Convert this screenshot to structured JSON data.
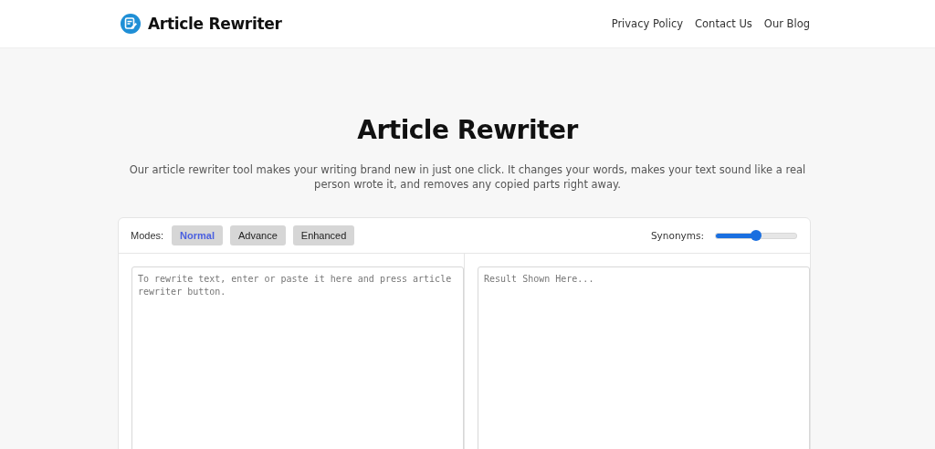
{
  "header": {
    "brand": "Article Rewriter",
    "nav": [
      "Privacy Policy",
      "Contact Us",
      "Our Blog"
    ]
  },
  "hero": {
    "title": "Article Rewriter",
    "description": "Our article rewriter tool makes your writing brand new in just one click. It changes your words, makes your text sound like a real person wrote it, and removes any copied parts right away."
  },
  "toolbar": {
    "modes_label": "Modes:",
    "modes": [
      {
        "label": "Normal",
        "selected": true
      },
      {
        "label": "Advance",
        "selected": false
      },
      {
        "label": "Enhanced",
        "selected": false
      }
    ],
    "synonyms_label": "Synonyms:",
    "synonyms": {
      "level": 0.5
    }
  },
  "input": {
    "placeholder": "To rewrite text, enter or paste it here and press article rewriter button."
  },
  "output": {
    "placeholder": "Result Shown Here..."
  }
}
